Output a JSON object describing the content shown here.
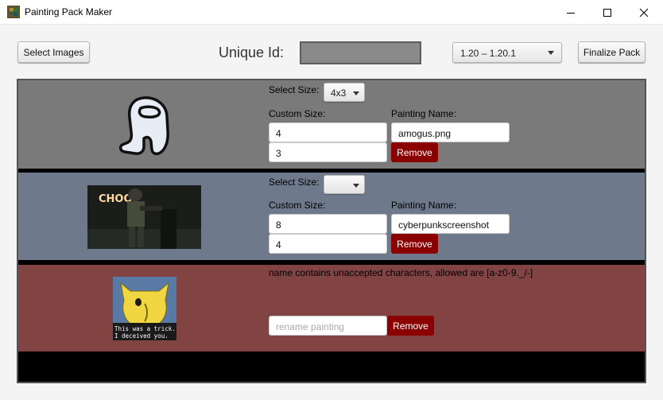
{
  "window": {
    "title": "Painting Pack Maker"
  },
  "toolbar": {
    "select_images_label": "Select Images",
    "unique_id_label": "Unique Id:",
    "unique_id_value": "",
    "version_selected": "1.20 – 1.20.1",
    "finalize_label": "Finalize Pack"
  },
  "paintings": [
    {
      "select_size_label": "Select Size:",
      "size_selected": "4x3",
      "custom_size_label": "Custom Size:",
      "width": "4",
      "height": "3",
      "painting_name_label": "Painting Name:",
      "name": "amogus.png",
      "remove_label": "Remove",
      "background_color": "#7a7a7a"
    },
    {
      "select_size_label": "Select Size:",
      "size_selected": "",
      "custom_size_label": "Custom Size:",
      "width": "8",
      "height": "4",
      "painting_name_label": "Painting Name:",
      "name": "cyberpunkscreenshot",
      "remove_label": "Remove",
      "background_color": "#6e7a8b",
      "image_text": "CHOO"
    },
    {
      "error_message": "name contains unaccepted characters, allowed are [a-z0-9._/-]",
      "rename_placeholder": "rename painting",
      "remove_label": "Remove",
      "background_color": "#824343",
      "image_caption_line1": "This was a trick.",
      "image_caption_line2": "I deceived you."
    }
  ],
  "icons": {
    "app": "painting-icon",
    "minimize": "minimize-icon",
    "maximize": "maximize-icon",
    "close": "close-icon",
    "dropdown": "chevron-down-icon"
  },
  "colors": {
    "remove_button": "#8b0000",
    "list_background": "#000000"
  }
}
